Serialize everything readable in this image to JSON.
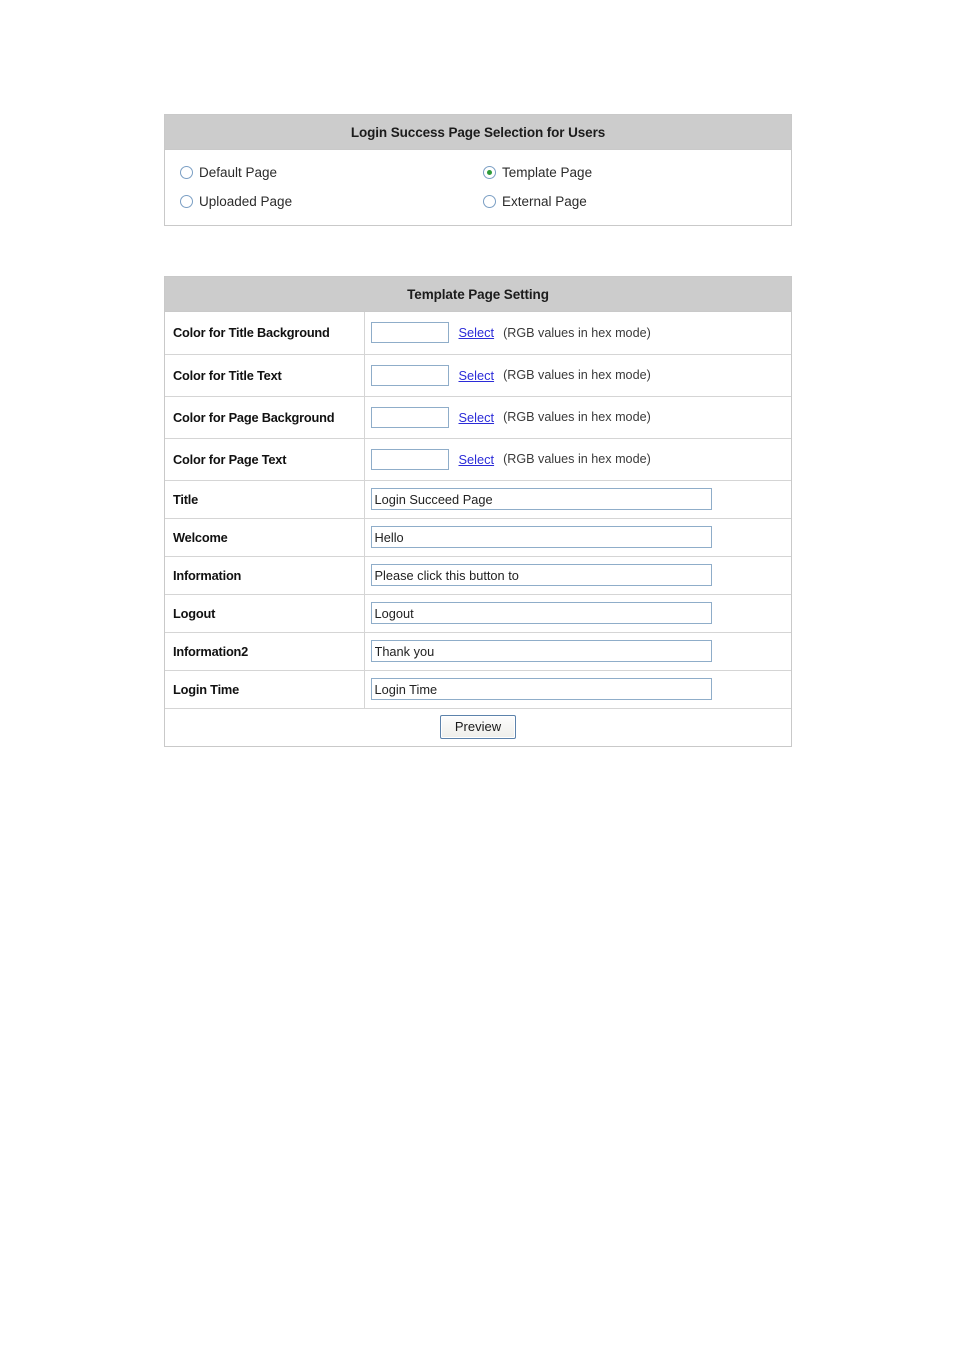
{
  "selection_panel": {
    "title": "Login Success Page Selection for Users",
    "options": [
      {
        "label": "Default Page",
        "selected": false,
        "name": "default-page"
      },
      {
        "label": "Template Page",
        "selected": true,
        "name": "template-page"
      },
      {
        "label": "Uploaded Page",
        "selected": false,
        "name": "uploaded-page"
      },
      {
        "label": "External Page",
        "selected": false,
        "name": "external-page"
      }
    ]
  },
  "settings_panel": {
    "title": "Template Page Setting",
    "select_link_label": "Select",
    "hex_note": "(RGB values in hex mode)",
    "color_rows": [
      {
        "label": "Color for Title Background",
        "value": "",
        "placeholder": ""
      },
      {
        "label": "Color for Title Text",
        "value": "",
        "placeholder": ""
      },
      {
        "label": "Color for Page Background",
        "value": "",
        "placeholder": ""
      },
      {
        "label": "Color for Page Text",
        "value": "",
        "placeholder": ""
      }
    ],
    "text_rows": [
      {
        "label": "Title",
        "value": "Login Succeed Page"
      },
      {
        "label": "Welcome",
        "value": "Hello"
      },
      {
        "label": "Information",
        "value": "Please click this button to"
      },
      {
        "label": "Logout",
        "value": "Logout"
      },
      {
        "label": "Information2",
        "value": "Thank you"
      },
      {
        "label": "Login Time",
        "value": "Login Time"
      }
    ],
    "preview_button_label": "Preview"
  },
  "colors": {
    "header_background": "#cccccc",
    "panel_border": "#c9c9c9",
    "row_border": "#d5d5d5",
    "input_border": "#8fadc9",
    "link": "#2b2bd8",
    "radio_ring": "#7b9fc4",
    "radio_dot": "#2e9b3a",
    "button_border": "#5c82ab"
  }
}
